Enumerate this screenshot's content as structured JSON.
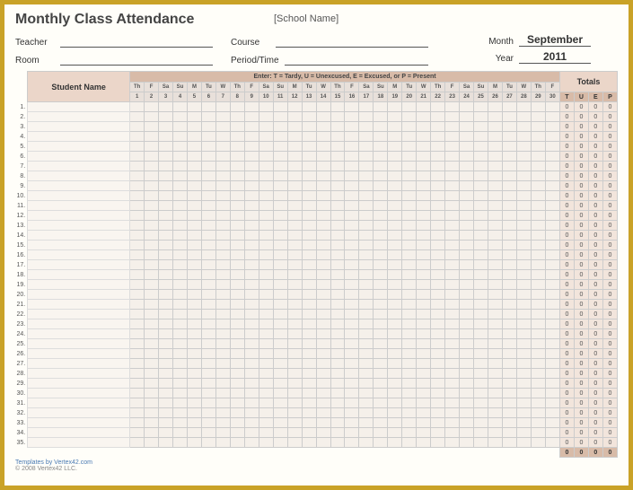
{
  "title": "Monthly Class Attendance",
  "school_placeholder": "[School Name]",
  "labels": {
    "teacher": "Teacher",
    "room": "Room",
    "course": "Course",
    "period": "Period/Time",
    "month": "Month",
    "year": "Year"
  },
  "values": {
    "month": "September",
    "year": "2011"
  },
  "legend": "Enter:  T = Tardy,   U = Unexcused,   E = Excused,  or P = Present",
  "headers": {
    "student_name": "Student Name",
    "totals": "Totals"
  },
  "days": [
    {
      "dow": "Th",
      "num": "1"
    },
    {
      "dow": "F",
      "num": "2"
    },
    {
      "dow": "Sa",
      "num": "3"
    },
    {
      "dow": "Su",
      "num": "4"
    },
    {
      "dow": "M",
      "num": "5"
    },
    {
      "dow": "Tu",
      "num": "6"
    },
    {
      "dow": "W",
      "num": "7"
    },
    {
      "dow": "Th",
      "num": "8"
    },
    {
      "dow": "F",
      "num": "9"
    },
    {
      "dow": "Sa",
      "num": "10"
    },
    {
      "dow": "Su",
      "num": "11"
    },
    {
      "dow": "M",
      "num": "12"
    },
    {
      "dow": "Tu",
      "num": "13"
    },
    {
      "dow": "W",
      "num": "14"
    },
    {
      "dow": "Th",
      "num": "15"
    },
    {
      "dow": "F",
      "num": "16"
    },
    {
      "dow": "Sa",
      "num": "17"
    },
    {
      "dow": "Su",
      "num": "18"
    },
    {
      "dow": "M",
      "num": "19"
    },
    {
      "dow": "Tu",
      "num": "20"
    },
    {
      "dow": "W",
      "num": "21"
    },
    {
      "dow": "Th",
      "num": "22"
    },
    {
      "dow": "F",
      "num": "23"
    },
    {
      "dow": "Sa",
      "num": "24"
    },
    {
      "dow": "Su",
      "num": "25"
    },
    {
      "dow": "M",
      "num": "26"
    },
    {
      "dow": "Tu",
      "num": "27"
    },
    {
      "dow": "W",
      "num": "28"
    },
    {
      "dow": "Th",
      "num": "29"
    },
    {
      "dow": "F",
      "num": "30"
    }
  ],
  "total_cols": [
    "T",
    "U",
    "E",
    "P"
  ],
  "row_count": 35,
  "row_totals": [
    "0",
    "0",
    "0",
    "0"
  ],
  "footer_totals": [
    "0",
    "0",
    "0",
    "0"
  ],
  "footer": {
    "link": "Templates by Vertex42.com",
    "copyright": "© 2008 Vertex42 LLC."
  }
}
